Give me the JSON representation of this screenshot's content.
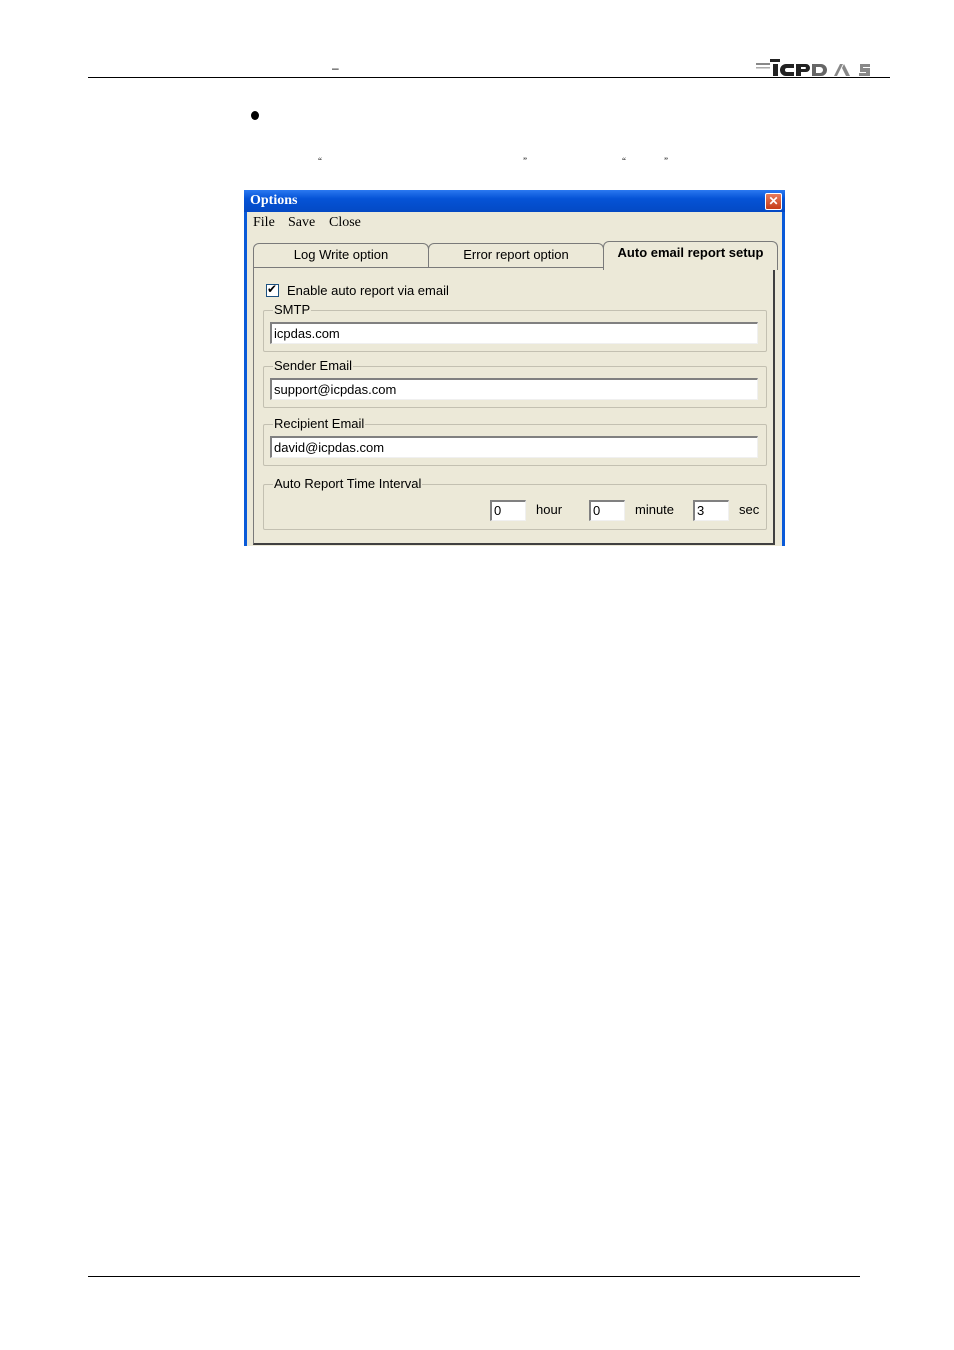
{
  "page": {
    "header_dash": "–",
    "logo_text": "ICPDAS",
    "quotes": [
      "“",
      "”",
      "“",
      "”"
    ]
  },
  "window": {
    "title": "Options",
    "close_glyph": "✕",
    "menu": [
      {
        "label": "File"
      },
      {
        "label": "Save"
      },
      {
        "label": "Close"
      }
    ],
    "tabs": [
      {
        "label": "Log Write option",
        "active": false
      },
      {
        "label": "Error report option",
        "active": false
      },
      {
        "label": "Auto email report setup",
        "active": true
      }
    ],
    "panel": {
      "enable_checkbox": {
        "label": "Enable auto report via email",
        "checked": true,
        "mark": "✔"
      },
      "smtp": {
        "label": "SMTP",
        "value": "icpdas.com"
      },
      "sender": {
        "label": "Sender Email",
        "value": "support@icpdas.com"
      },
      "recipient": {
        "label": "Recipient Email",
        "value": "david@icpdas.com"
      },
      "interval": {
        "label": "Auto Report Time Interval",
        "hour": {
          "value": "0",
          "unit": "hour"
        },
        "minute": {
          "value": "0",
          "unit": "minute"
        },
        "sec": {
          "value": "3",
          "unit": "sec"
        }
      }
    }
  }
}
